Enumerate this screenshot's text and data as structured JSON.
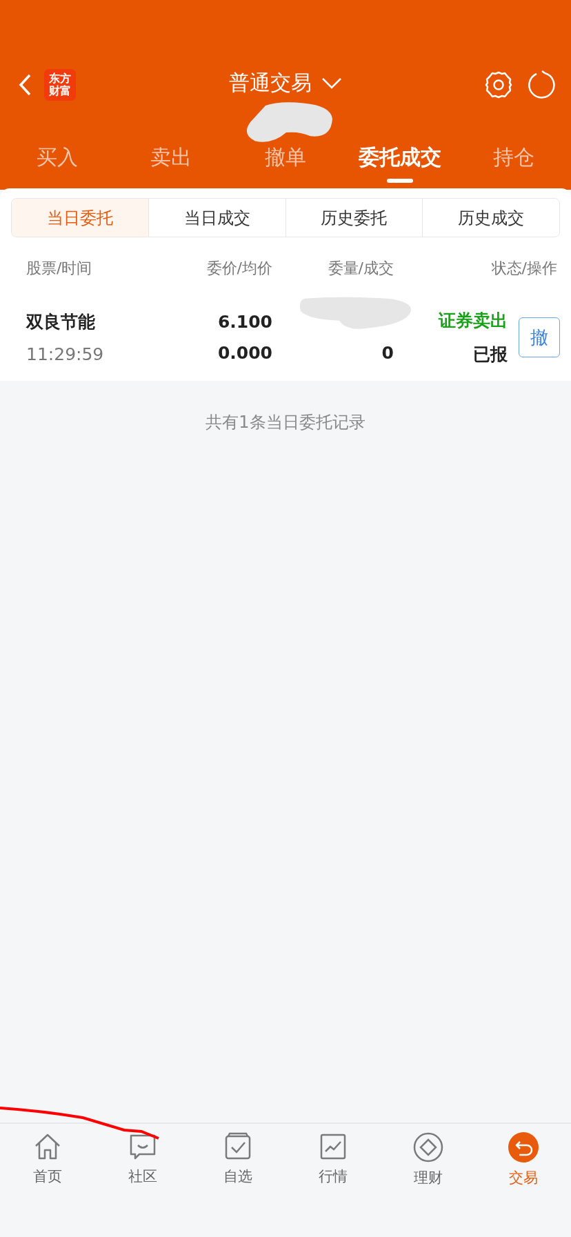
{
  "header": {
    "title": "普通交易",
    "logo_lines": [
      "东方",
      "财富"
    ]
  },
  "tabs": [
    {
      "label": "买入",
      "selected": false
    },
    {
      "label": "卖出",
      "selected": false
    },
    {
      "label": "撤单",
      "selected": false
    },
    {
      "label": "委托成交",
      "selected": true
    },
    {
      "label": "持仓",
      "selected": false
    }
  ],
  "sub_tabs": [
    {
      "label": "当日委托",
      "selected": true
    },
    {
      "label": "当日成交",
      "selected": false
    },
    {
      "label": "历史委托",
      "selected": false
    },
    {
      "label": "历史成交",
      "selected": false
    }
  ],
  "columns": [
    "股票/时间",
    "委价/均价",
    "委量/成交",
    "状态/操作"
  ],
  "orders": [
    {
      "name": "双良节能",
      "time": "11:29:59",
      "price": "6.100",
      "avg_price": "0.000",
      "filled": "0",
      "direction": "证券卖出",
      "status": "已报",
      "action": "撤"
    }
  ],
  "footer_note": "共有1条当日委托记录",
  "nav": [
    {
      "label": "首页",
      "kind": "home",
      "selected": false
    },
    {
      "label": "社区",
      "kind": "chat",
      "selected": false
    },
    {
      "label": "自选",
      "kind": "check",
      "selected": false
    },
    {
      "label": "行情",
      "kind": "chart",
      "selected": false
    },
    {
      "label": "理财",
      "kind": "diamond",
      "selected": false
    },
    {
      "label": "交易",
      "kind": "exchange",
      "selected": true
    }
  ]
}
